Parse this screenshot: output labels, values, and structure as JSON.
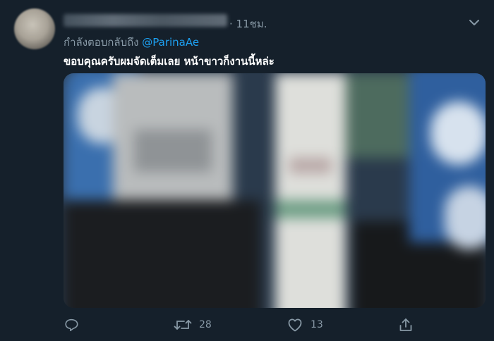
{
  "tweet": {
    "time": "· 11ชม.",
    "reply_prefix": "กำลังตอบกลับถึง",
    "reply_to": "@ParinaAe",
    "text": "ขอบคุณครับผมจัดเต็มเลย หน้าขาวก็งานนี้หล่ะ"
  },
  "actions": {
    "reply_count": "",
    "retweet_count": "28",
    "like_count": "13"
  },
  "colors": {
    "background": "#15202b",
    "muted_text": "#8899a6",
    "link": "#1da1f2"
  },
  "icons": [
    "reply-icon",
    "retweet-icon",
    "like-icon",
    "share-icon",
    "chevron-down-icon"
  ]
}
